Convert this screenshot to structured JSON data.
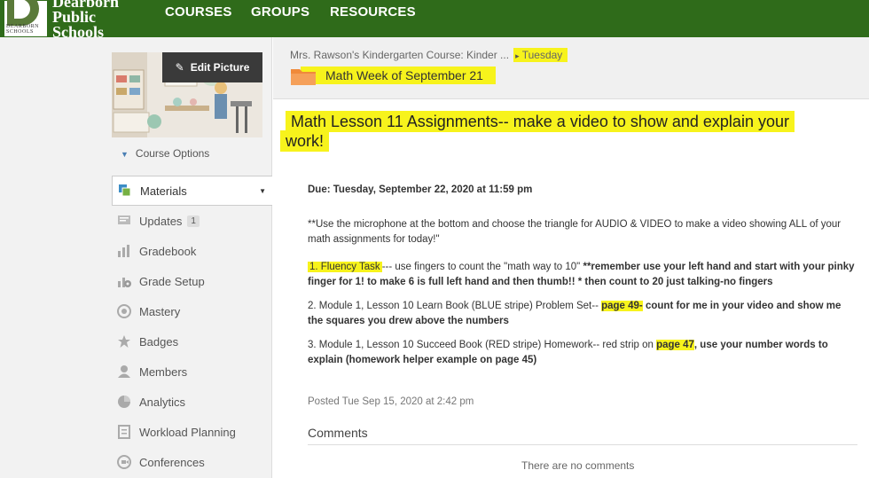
{
  "brand": {
    "line1": "Dearborn",
    "line2": "Public",
    "line3": "Schools",
    "logo_text": "DEARBORN SCHOOLS"
  },
  "nav": {
    "courses": "COURSES",
    "groups": "GROUPS",
    "resources": "RESOURCES"
  },
  "sidebar": {
    "edit_picture": "Edit Picture",
    "course_options": "Course Options",
    "items": [
      {
        "label": "Materials"
      },
      {
        "label": "Updates",
        "badge": "1"
      },
      {
        "label": "Gradebook"
      },
      {
        "label": "Grade Setup"
      },
      {
        "label": "Mastery"
      },
      {
        "label": "Badges"
      },
      {
        "label": "Members"
      },
      {
        "label": "Analytics"
      },
      {
        "label": "Workload Planning"
      },
      {
        "label": "Conferences"
      }
    ]
  },
  "breadcrumb": {
    "course": "Mrs. Rawson's Kindergarten Course: Kinder ...",
    "sep": "▸",
    "current": "Tuesday"
  },
  "folder": {
    "name": "Math Week of September 21"
  },
  "title": {
    "line1": "Math Lesson 11 Assignments-- make a video to show and explain your",
    "line2": "work!"
  },
  "assignment": {
    "due": "Due: Tuesday, September 22, 2020 at 11:59 pm",
    "intro": "**Use the microphone at the bottom and choose the triangle for AUDIO & VIDEO to make a video showing ALL of your math assignments for today!\"",
    "item1_label": "1.  Fluency Task",
    "item1_text": "--- use fingers to count the \"math way to 10\"  ",
    "item1_bold": "**remember use your left hand and start with your pinky finger for 1! to make 6 is full left hand and then thumb!!    * then count to 20 just talking-no fingers",
    "item2_text": "2.  Module 1, Lesson 10 Learn Book (BLUE stripe) Problem Set-- ",
    "item2_page": "page 49-",
    "item2_bold": " count for me in your video and show me the squares you drew above the numbers",
    "item3_text": "3. Module 1, Lesson 10 Succeed Book (RED stripe) Homework-- red strip on ",
    "item3_page": "page 47",
    "item3_bold": ", use your number words to explain (homework helper example on page 45)",
    "posted": "Posted Tue Sep 15, 2020 at 2:42 pm"
  },
  "comments": {
    "heading": "Comments",
    "empty": "There are no comments"
  },
  "colors": {
    "topbar": "#2f6b1a",
    "highlight": "#f7f31c",
    "folder": "#f08a3a"
  }
}
